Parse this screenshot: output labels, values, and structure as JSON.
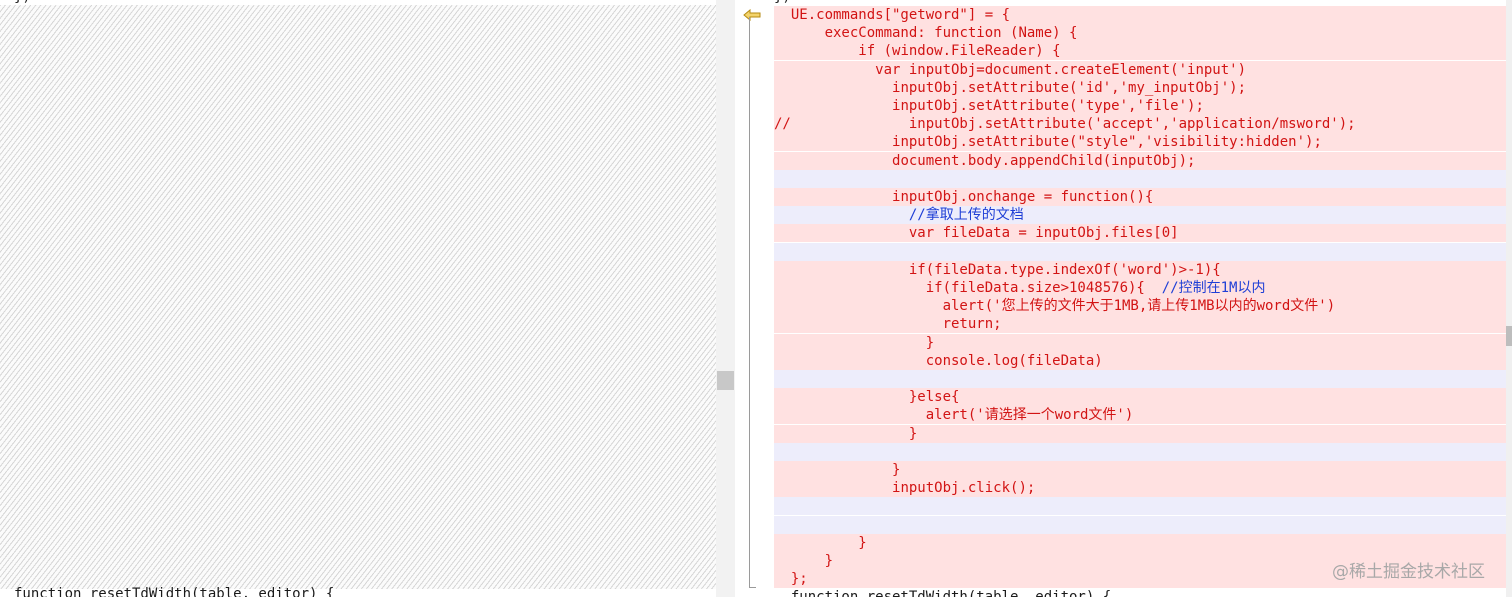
{
  "left_pane": {
    "stub_text": "})",
    "bottom_line": "function resetTdWidth(table, editor) {"
  },
  "right_pane": {
    "stub_text": "})",
    "lines": [
      {
        "kind": "changed",
        "indent": "  ",
        "code": "UE.commands[\"getword\"] = {",
        "comment": ""
      },
      {
        "kind": "changed",
        "indent": "      ",
        "code": "execCommand: function (Name) {",
        "comment": ""
      },
      {
        "kind": "changed",
        "indent": "          ",
        "code": "if (window.FileReader) {",
        "comment": ""
      },
      {
        "kind": "changed",
        "indent": "            ",
        "code": "var inputObj=document.createElement('input')",
        "comment": ""
      },
      {
        "kind": "changed",
        "indent": "              ",
        "code": "inputObj.setAttribute('id','my_inputObj');",
        "comment": ""
      },
      {
        "kind": "changed",
        "indent": "              ",
        "code": "inputObj.setAttribute('type','file');",
        "comment": ""
      },
      {
        "kind": "changed",
        "indent": "",
        "code": "//              inputObj.setAttribute('accept','application/msword');",
        "comment": ""
      },
      {
        "kind": "changed",
        "indent": "              ",
        "code": "inputObj.setAttribute(\"style\",'visibility:hidden');",
        "comment": ""
      },
      {
        "kind": "changed",
        "indent": "              ",
        "code": "document.body.appendChild(inputObj);",
        "comment": ""
      },
      {
        "kind": "blank",
        "indent": "",
        "code": "",
        "comment": ""
      },
      {
        "kind": "changed",
        "indent": "              ",
        "code": "inputObj.onchange = function(){",
        "comment": ""
      },
      {
        "kind": "blank",
        "indent": "                ",
        "code": "",
        "comment": "//拿取上传的文档"
      },
      {
        "kind": "changed",
        "indent": "                ",
        "code": "var fileData = inputObj.files[0]",
        "comment": ""
      },
      {
        "kind": "blank",
        "indent": "",
        "code": "",
        "comment": ""
      },
      {
        "kind": "changed",
        "indent": "                ",
        "code": "if(fileData.type.indexOf('word')>-1){",
        "comment": ""
      },
      {
        "kind": "changed",
        "indent": "                  ",
        "code": "if(fileData.size>1048576){  ",
        "comment": "//控制在1M以内"
      },
      {
        "kind": "changed",
        "indent": "                    ",
        "code": "alert('您上传的文件大于1MB,请上传1MB以内的word文件')",
        "comment": ""
      },
      {
        "kind": "changed",
        "indent": "                    ",
        "code": "return;",
        "comment": ""
      },
      {
        "kind": "changed",
        "indent": "                  ",
        "code": "}",
        "comment": ""
      },
      {
        "kind": "changed",
        "indent": "                  ",
        "code": "console.log(fileData)",
        "comment": ""
      },
      {
        "kind": "blank",
        "indent": "",
        "code": "",
        "comment": ""
      },
      {
        "kind": "changed",
        "indent": "                ",
        "code": "}else{",
        "comment": ""
      },
      {
        "kind": "changed",
        "indent": "                  ",
        "code": "alert('请选择一个word文件')",
        "comment": ""
      },
      {
        "kind": "changed",
        "indent": "                ",
        "code": "}",
        "comment": ""
      },
      {
        "kind": "blank",
        "indent": "",
        "code": "",
        "comment": ""
      },
      {
        "kind": "changed",
        "indent": "              ",
        "code": "}",
        "comment": ""
      },
      {
        "kind": "changed",
        "indent": "              ",
        "code": "inputObj.click();",
        "comment": ""
      },
      {
        "kind": "blank",
        "indent": "",
        "code": "",
        "comment": ""
      },
      {
        "kind": "blank",
        "indent": "",
        "code": "",
        "comment": ""
      },
      {
        "kind": "changed",
        "indent": "          ",
        "code": "}",
        "comment": ""
      },
      {
        "kind": "changed",
        "indent": "      ",
        "code": "}",
        "comment": ""
      },
      {
        "kind": "changed",
        "indent": "  ",
        "code": "};",
        "comment": ""
      },
      {
        "kind": "plain",
        "indent": "  ",
        "code": "function resetTdWidth(table, editor) {",
        "comment": ""
      }
    ]
  },
  "watermark": "@稀土掘金技术社区",
  "colors": {
    "changed_bg": "#ffe1e1",
    "changed_text": "#d21414",
    "blank_bg": "#ededfb",
    "comment_text": "#1f3fd6",
    "arrow_fill": "#f3d36b"
  },
  "icons": {
    "diff_arrow": "arrow-left-icon"
  }
}
